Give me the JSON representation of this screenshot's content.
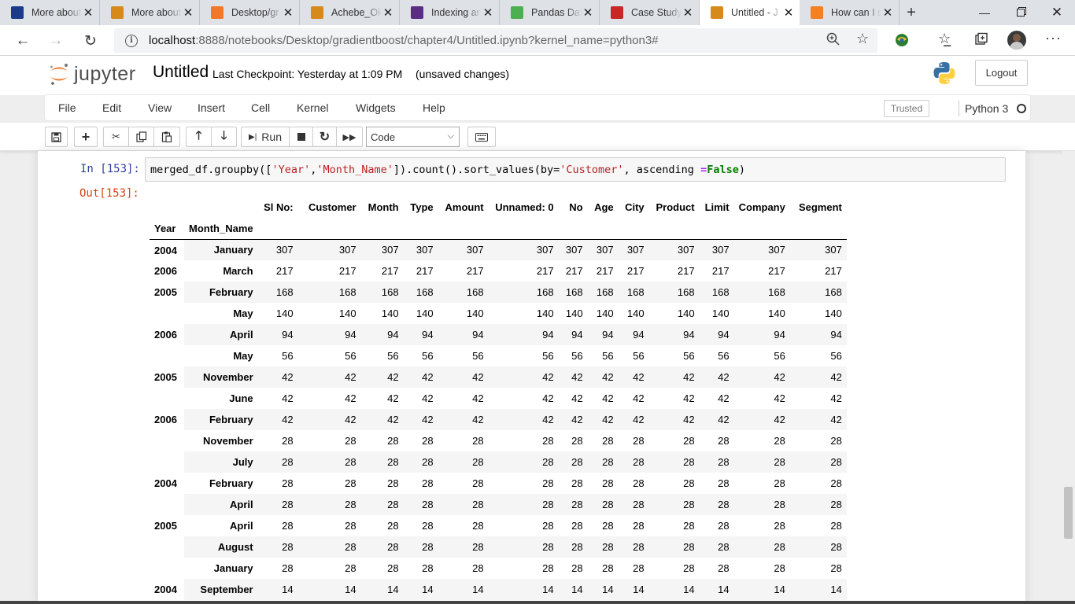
{
  "browser": {
    "tabs": [
      {
        "label": "More about",
        "icon": "sparkle-icon",
        "color": "#1a3a8a"
      },
      {
        "label": "More about",
        "icon": "book-icon",
        "color": "#d68a1c"
      },
      {
        "label": "Desktop/gr",
        "icon": "jupyter-icon",
        "color": "#f37726"
      },
      {
        "label": "Achebe_Ok",
        "icon": "book-icon",
        "color": "#d68a1c"
      },
      {
        "label": "Indexing ar",
        "icon": "bars-icon",
        "color": "#5b2c83"
      },
      {
        "label": "Pandas Dat",
        "icon": "w3-icon",
        "color": "#4caf50"
      },
      {
        "label": "Case Study",
        "icon": "pdf-icon",
        "color": "#c62828"
      },
      {
        "label": "Untitled - J",
        "icon": "book-icon",
        "color": "#d68a1c",
        "active": true
      },
      {
        "label": "How can I s",
        "icon": "stack-icon",
        "color": "#f48024"
      }
    ],
    "tab_close": "✕",
    "new_tab": "+",
    "url_host": "localhost",
    "url_path": ":8888/notebooks/Desktop/gradientboost/chapter4/Untitled.ipynb?kernel_name=python3#"
  },
  "jupyter": {
    "brand": "jupyter",
    "notebook_title": "Untitled",
    "checkpoint": "Last Checkpoint: Yesterday at 1:09 PM",
    "unsaved": "(unsaved changes)",
    "logout": "Logout",
    "menu": [
      "File",
      "Edit",
      "View",
      "Insert",
      "Cell",
      "Kernel",
      "Widgets",
      "Help"
    ],
    "trusted": "Trusted",
    "kernel": "Python 3",
    "run_label": "Run",
    "cell_type": "Code"
  },
  "cell": {
    "in_prompt": "In [153]:",
    "out_prompt": "Out[153]:",
    "code_parts": {
      "p1": "merged_df.groupby([",
      "s1": "'Year'",
      "p2": ",",
      "s2": "'Month_Name'",
      "p3": "]).count().sort_values(by=",
      "s3": "'Customer'",
      "p4": ", ascending ",
      "op": "=",
      "kw": "False",
      "p5": ")"
    }
  },
  "table": {
    "columns": [
      "Sl No:",
      "Customer",
      "Month",
      "Type",
      "Amount",
      "Unnamed: 0",
      "No",
      "Age",
      "City",
      "Product",
      "Limit",
      "Company",
      "Segment"
    ],
    "index_names": [
      "Year",
      "Month_Name"
    ],
    "groups": [
      {
        "year": "2004",
        "rows": [
          {
            "month": "January",
            "value": "307"
          }
        ]
      },
      {
        "year": "2006",
        "rows": [
          {
            "month": "March",
            "value": "217"
          }
        ]
      },
      {
        "year": "2005",
        "rows": [
          {
            "month": "February",
            "value": "168"
          },
          {
            "month": "May",
            "value": "140"
          }
        ]
      },
      {
        "year": "2006",
        "rows": [
          {
            "month": "April",
            "value": "94"
          },
          {
            "month": "May",
            "value": "56"
          }
        ]
      },
      {
        "year": "2005",
        "rows": [
          {
            "month": "November",
            "value": "42"
          },
          {
            "month": "June",
            "value": "42"
          }
        ]
      },
      {
        "year": "2006",
        "rows": [
          {
            "month": "February",
            "value": "42"
          },
          {
            "month": "November",
            "value": "28"
          },
          {
            "month": "July",
            "value": "28"
          }
        ]
      },
      {
        "year": "2004",
        "rows": [
          {
            "month": "February",
            "value": "28"
          },
          {
            "month": "April",
            "value": "28"
          }
        ]
      },
      {
        "year": "2005",
        "rows": [
          {
            "month": "April",
            "value": "28"
          },
          {
            "month": "August",
            "value": "28"
          },
          {
            "month": "January",
            "value": "28"
          }
        ]
      },
      {
        "year": "2004",
        "rows": [
          {
            "month": "September",
            "value": "14"
          }
        ]
      }
    ]
  }
}
